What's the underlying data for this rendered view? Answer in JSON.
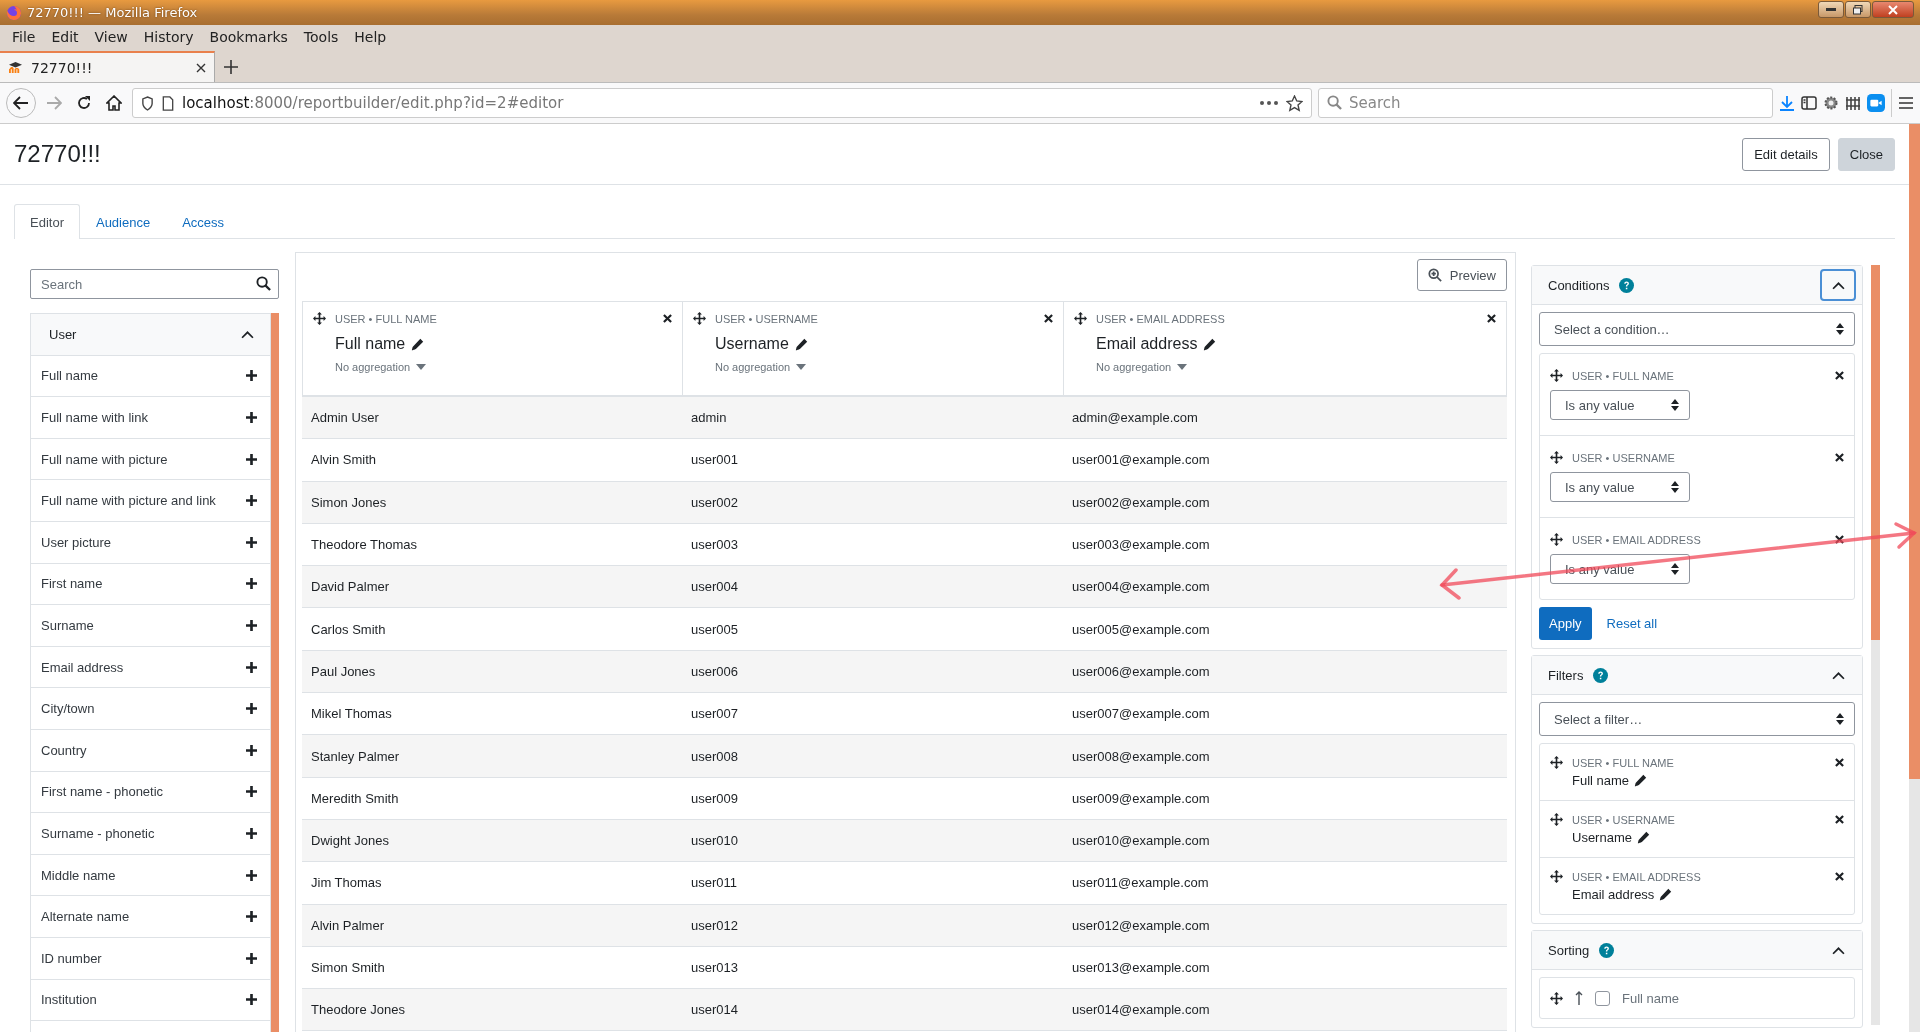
{
  "browser": {
    "window_title": "72770!!! — Mozilla Firefox",
    "menu": [
      "File",
      "Edit",
      "View",
      "History",
      "Bookmarks",
      "Tools",
      "Help"
    ],
    "tab_title": "72770!!!",
    "url_host": "localhost",
    "url_path": ":8000/reportbuilder/edit.php?id=2#editor",
    "search_placeholder": "Search"
  },
  "page": {
    "heading": "72770!!!",
    "buttons": [
      "Edit details",
      "Close"
    ],
    "tabs": [
      {
        "label": "Editor",
        "selected": true
      },
      {
        "label": "Audience",
        "selected": false
      },
      {
        "label": "Access",
        "selected": false
      }
    ]
  },
  "sidebar": {
    "search_placeholder": "Search",
    "group": {
      "label": "User",
      "expanded": true
    },
    "items": [
      "Full name",
      "Full name with link",
      "Full name with picture",
      "Full name with picture and link",
      "User picture",
      "First name",
      "Surname",
      "Email address",
      "City/town",
      "Country",
      "First name - phonetic",
      "Surname - phonetic",
      "Middle name",
      "Alternate name",
      "ID number",
      "Institution"
    ]
  },
  "report": {
    "preview": "Preview",
    "columns": [
      {
        "source": "USER • FULL NAME",
        "title": "Full name",
        "aggregation": "No aggregation"
      },
      {
        "source": "USER • USERNAME",
        "title": "Username",
        "aggregation": "No aggregation"
      },
      {
        "source": "USER • EMAIL ADDRESS",
        "title": "Email address",
        "aggregation": "No aggregation"
      }
    ],
    "rows": [
      [
        "Admin User",
        "admin",
        "admin@example.com"
      ],
      [
        "Alvin Smith",
        "user001",
        "user001@example.com"
      ],
      [
        "Simon Jones",
        "user002",
        "user002@example.com"
      ],
      [
        "Theodore Thomas",
        "user003",
        "user003@example.com"
      ],
      [
        "David Palmer",
        "user004",
        "user004@example.com"
      ],
      [
        "Carlos Smith",
        "user005",
        "user005@example.com"
      ],
      [
        "Paul Jones",
        "user006",
        "user006@example.com"
      ],
      [
        "Mikel Thomas",
        "user007",
        "user007@example.com"
      ],
      [
        "Stanley Palmer",
        "user008",
        "user008@example.com"
      ],
      [
        "Meredith Smith",
        "user009",
        "user009@example.com"
      ],
      [
        "Dwight Jones",
        "user010",
        "user010@example.com"
      ],
      [
        "Jim Thomas",
        "user011",
        "user011@example.com"
      ],
      [
        "Alvin Palmer",
        "user012",
        "user012@example.com"
      ],
      [
        "Simon Smith",
        "user013",
        "user013@example.com"
      ],
      [
        "Theodore Jones",
        "user014",
        "user014@example.com"
      ]
    ]
  },
  "conditions": {
    "title": "Conditions",
    "expanded": true,
    "select_placeholder": "Select a condition…",
    "items": [
      {
        "source": "USER • FULL NAME",
        "operator": "Is any value"
      },
      {
        "source": "USER • USERNAME",
        "operator": "Is any value"
      },
      {
        "source": "USER • EMAIL ADDRESS",
        "operator": "Is any value"
      }
    ],
    "apply": "Apply",
    "reset": "Reset all"
  },
  "filters": {
    "title": "Filters",
    "expanded": true,
    "select_placeholder": "Select a filter…",
    "items": [
      {
        "source": "USER • FULL NAME",
        "label": "Full name"
      },
      {
        "source": "USER • USERNAME",
        "label": "Username"
      },
      {
        "source": "USER • EMAIL ADDRESS",
        "label": "Email address"
      }
    ]
  },
  "sorting": {
    "title": "Sorting",
    "expanded": true,
    "items": [
      {
        "label": "Full name",
        "checked": false
      }
    ]
  }
}
